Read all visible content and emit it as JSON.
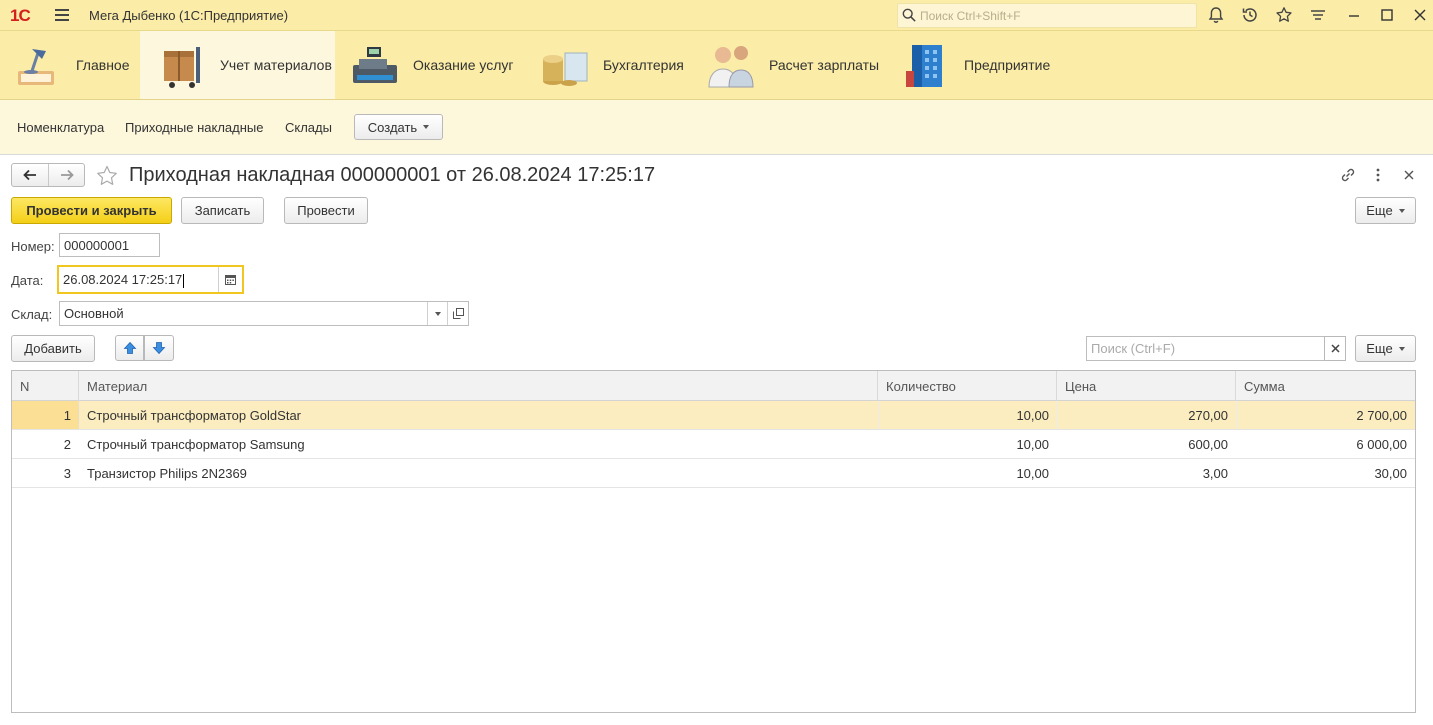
{
  "titlebar": {
    "logo": "1С",
    "app_title": "Мега Дыбенко  (1С:Предприятие)",
    "search_placeholder": "Поиск Ctrl+Shift+F"
  },
  "sections": [
    {
      "label": "Главное",
      "icon": "desk-lamp-icon",
      "active": false
    },
    {
      "label": "Учет материалов",
      "icon": "boxes-cart-icon",
      "active": true
    },
    {
      "label": "Оказание услуг",
      "icon": "cash-register-icon",
      "active": false
    },
    {
      "label": "Бухгалтерия",
      "icon": "coins-icon",
      "active": false
    },
    {
      "label": "Расчет зарплаты",
      "icon": "people-icon",
      "active": false
    },
    {
      "label": "Предприятие",
      "icon": "building-icon",
      "active": false
    }
  ],
  "subnav": {
    "links": [
      "Номенклатура",
      "Приходные накладные",
      "Склады"
    ],
    "create_label": "Создать"
  },
  "form": {
    "title": "Приходная накладная 000000001 от 26.08.2024 17:25:17",
    "post_close_label": "Провести и закрыть",
    "save_label": "Записать",
    "post_label": "Провести",
    "more_label": "Еще",
    "number_label": "Номер:",
    "number_value": "000000001",
    "date_label": "Дата:",
    "date_value": "26.08.2024 17:25:17",
    "warehouse_label": "Склад:",
    "warehouse_value": "Основной"
  },
  "table_toolbar": {
    "add_label": "Добавить",
    "search_placeholder": "Поиск (Ctrl+F)",
    "more_label": "Еще"
  },
  "table": {
    "columns": [
      "N",
      "Материал",
      "Количество",
      "Цена",
      "Сумма"
    ],
    "rows": [
      {
        "n": "1",
        "material": "Строчный трансформатор GoldStar",
        "qty": "10,00",
        "price": "270,00",
        "sum": "2 700,00"
      },
      {
        "n": "2",
        "material": "Строчный трансформатор Samsung",
        "qty": "10,00",
        "price": "600,00",
        "sum": "6 000,00"
      },
      {
        "n": "3",
        "material": "Транзистор Philips 2N2369",
        "qty": "10,00",
        "price": "3,00",
        "sum": "30,00"
      }
    ],
    "selected_row": 0
  },
  "colors": {
    "accent_yellow": "#f4cf17",
    "panel_yellow": "#fbeca8",
    "selected_row": "#fbedc0"
  }
}
